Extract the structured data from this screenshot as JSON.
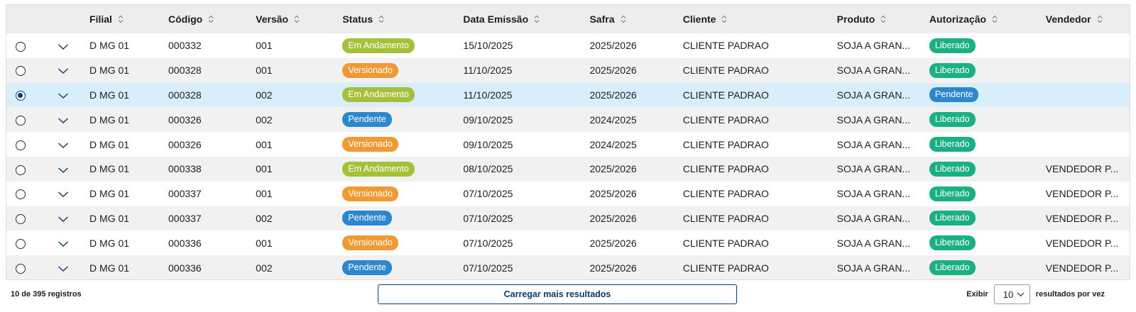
{
  "colors": {
    "header_bg": "#ededed",
    "row_odd": "#ffffff",
    "row_even": "#f1f1f1",
    "row_selected": "#d9eefb",
    "accent": "#0c3b6e",
    "tag_em_andamento": "#a5c13a",
    "tag_versionado": "#ef9a34",
    "tag_pendente": "#2d87cf",
    "tag_liberado": "#1bb083"
  },
  "icons": {
    "sort": "sort-arrows-icon",
    "expand": "chevron-down-icon",
    "select": "chevron-down-icon"
  },
  "table": {
    "columns": [
      {
        "key": "select",
        "label": ""
      },
      {
        "key": "expand",
        "label": ""
      },
      {
        "key": "filial",
        "label": "Filial",
        "sortable": true
      },
      {
        "key": "codigo",
        "label": "Código",
        "sortable": true
      },
      {
        "key": "versao",
        "label": "Versão",
        "sortable": true
      },
      {
        "key": "status",
        "label": "Status",
        "sortable": true
      },
      {
        "key": "data_emissao",
        "label": "Data Emissão",
        "sortable": true
      },
      {
        "key": "safra",
        "label": "Safra",
        "sortable": true
      },
      {
        "key": "cliente",
        "label": "Cliente",
        "sortable": true
      },
      {
        "key": "produto",
        "label": "Produto",
        "sortable": true
      },
      {
        "key": "autorizacao",
        "label": "Autorização",
        "sortable": true
      },
      {
        "key": "vendedor",
        "label": "Vendedor",
        "sortable": true
      }
    ],
    "rows": [
      {
        "selected": false,
        "filial": "D MG 01",
        "codigo": "000332",
        "versao": "001",
        "status": "Em Andamento",
        "data_emissao": "15/10/2025",
        "safra": "2025/2026",
        "cliente": "CLIENTE PADRAO",
        "produto": "SOJA A GRAN...",
        "autorizacao": "Liberado",
        "vendedor": ""
      },
      {
        "selected": false,
        "filial": "D MG 01",
        "codigo": "000328",
        "versao": "001",
        "status": "Versionado",
        "data_emissao": "11/10/2025",
        "safra": "2025/2026",
        "cliente": "CLIENTE PADRAO",
        "produto": "SOJA A GRAN...",
        "autorizacao": "Liberado",
        "vendedor": ""
      },
      {
        "selected": true,
        "filial": "D MG 01",
        "codigo": "000328",
        "versao": "002",
        "status": "Em Andamento",
        "data_emissao": "11/10/2025",
        "safra": "2025/2026",
        "cliente": "CLIENTE PADRAO",
        "produto": "SOJA A GRAN...",
        "autorizacao": "Pendente",
        "vendedor": ""
      },
      {
        "selected": false,
        "filial": "D MG 01",
        "codigo": "000326",
        "versao": "002",
        "status": "Pendente",
        "data_emissao": "09/10/2025",
        "safra": "2024/2025",
        "cliente": "CLIENTE PADRAO",
        "produto": "SOJA A GRAN...",
        "autorizacao": "Liberado",
        "vendedor": ""
      },
      {
        "selected": false,
        "filial": "D MG 01",
        "codigo": "000326",
        "versao": "001",
        "status": "Versionado",
        "data_emissao": "09/10/2025",
        "safra": "2024/2025",
        "cliente": "CLIENTE PADRAO",
        "produto": "SOJA A GRAN...",
        "autorizacao": "Liberado",
        "vendedor": ""
      },
      {
        "selected": false,
        "filial": "D MG 01",
        "codigo": "000338",
        "versao": "001",
        "status": "Em Andamento",
        "data_emissao": "08/10/2025",
        "safra": "2025/2026",
        "cliente": "CLIENTE PADRAO",
        "produto": "SOJA A GRAN...",
        "autorizacao": "Liberado",
        "vendedor": "VENDEDOR P..."
      },
      {
        "selected": false,
        "filial": "D MG 01",
        "codigo": "000337",
        "versao": "001",
        "status": "Versionado",
        "data_emissao": "07/10/2025",
        "safra": "2025/2026",
        "cliente": "CLIENTE PADRAO",
        "produto": "SOJA A GRAN...",
        "autorizacao": "Liberado",
        "vendedor": "VENDEDOR P..."
      },
      {
        "selected": false,
        "filial": "D MG 01",
        "codigo": "000337",
        "versao": "002",
        "status": "Pendente",
        "data_emissao": "07/10/2025",
        "safra": "2025/2026",
        "cliente": "CLIENTE PADRAO",
        "produto": "SOJA A GRAN...",
        "autorizacao": "Liberado",
        "vendedor": "VENDEDOR P..."
      },
      {
        "selected": false,
        "filial": "D MG 01",
        "codigo": "000336",
        "versao": "001",
        "status": "Versionado",
        "data_emissao": "07/10/2025",
        "safra": "2025/2026",
        "cliente": "CLIENTE PADRAO",
        "produto": "SOJA A GRAN...",
        "autorizacao": "Liberado",
        "vendedor": "VENDEDOR P..."
      },
      {
        "selected": false,
        "filial": "D MG 01",
        "codigo": "000336",
        "versao": "002",
        "status": "Pendente",
        "data_emissao": "07/10/2025",
        "safra": "2025/2026",
        "cliente": "CLIENTE PADRAO",
        "produto": "SOJA A GRAN...",
        "autorizacao": "Liberado",
        "vendedor": "VENDEDOR P..."
      }
    ]
  },
  "footer": {
    "record_count": "10 de 395 registros",
    "load_more_label": "Carregar mais resultados",
    "show_label": "Exibir",
    "page_size_value": "10",
    "per_page_label": "resultados por vez"
  }
}
